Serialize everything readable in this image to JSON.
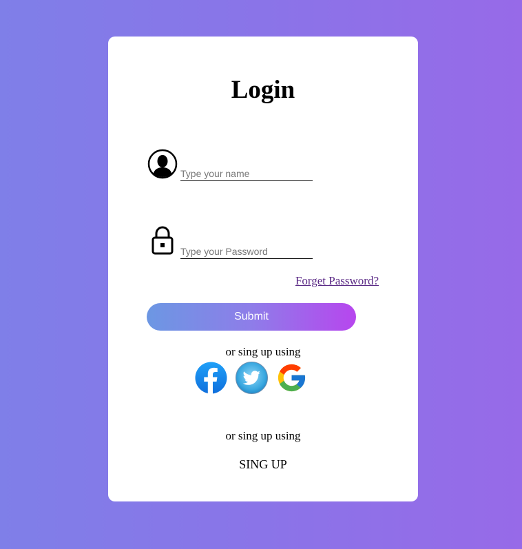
{
  "login": {
    "title": "Login",
    "name_field": {
      "placeholder": "Type your name",
      "value": ""
    },
    "password_field": {
      "placeholder": "Type your Password",
      "value": ""
    },
    "forgot_label": "Forget Password?",
    "submit_label": "Submit",
    "alt_signup_text": "or sing up using",
    "socials": [
      {
        "name": "facebook-icon",
        "color": "#1877f2"
      },
      {
        "name": "twitter-icon",
        "color": "#1d9bf0"
      },
      {
        "name": "google-icon",
        "color": "#4285f4"
      }
    ],
    "alt_signup_text_2": "or sing up using",
    "signup_label": "SING UP"
  },
  "colors": {
    "bg_start": "#7f7fe8",
    "bg_end": "#976ae8",
    "submit_start": "#6c97e3",
    "submit_end": "#b746ee",
    "link": "#5b2a86"
  }
}
